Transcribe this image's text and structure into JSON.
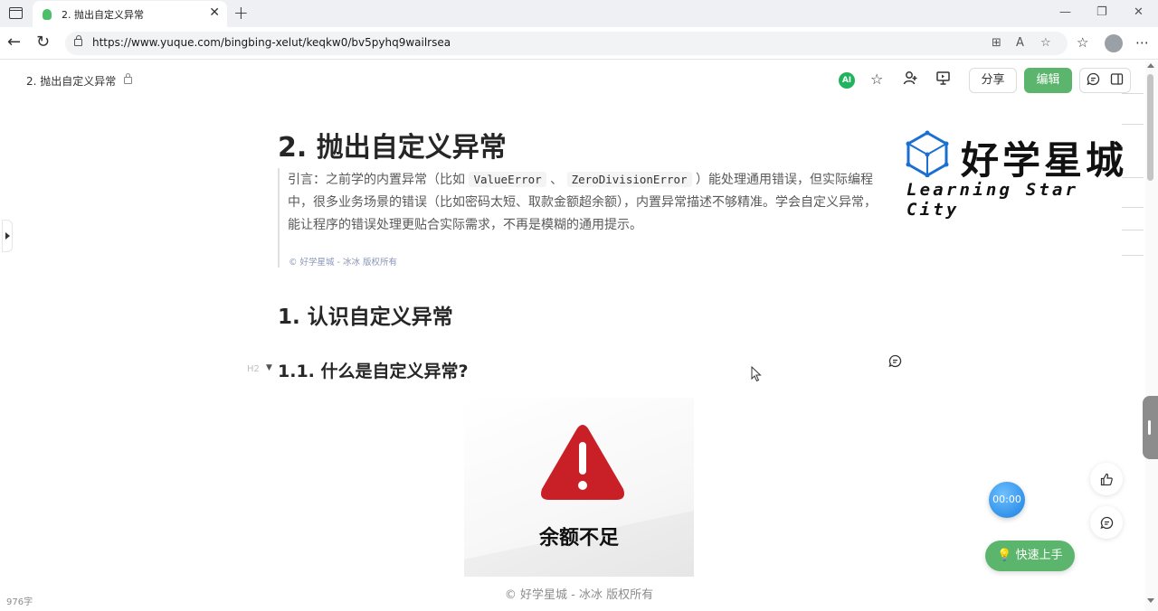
{
  "browser": {
    "tab_title": "2. 抛出自定义异常",
    "tab_close": "✕",
    "new_tab": "+",
    "url": "https://www.yuque.com/bingbing-xelut/keqkw0/bv5pyhq9wailrsea",
    "window_min": "—",
    "window_restore": "❐",
    "window_close": "✕",
    "back": "←",
    "reload": "↻",
    "more": "⋯"
  },
  "header": {
    "doc_title": "2. 抛出自定义异常",
    "ai_label": "AI",
    "share_label": "分享",
    "edit_label": "编辑"
  },
  "article": {
    "title": "2. 抛出自定义异常",
    "quote": {
      "part1": "引言：之前学的内置异常（比如 ",
      "code1": "ValueError",
      "sep": " 、 ",
      "code2": "ZeroDivisionError",
      "part2": " ）能处理通用错误，但实际编程中，很多业务场景的错误（比如密码太短、取款金额超余额），内置异常描述不够精准。学会自定义异常，能让程序的错误处理更贴合实际需求，不再是模糊的通用提示。",
      "copyright": "© 好学星城 - 冰冰 版权所有"
    },
    "logo": {
      "cn": "好学星城",
      "en": "Learning Star City"
    },
    "h2": "1. 认识自定义异常",
    "h3_marker": "H2",
    "h3": "1.1. 什么是自定义异常?",
    "image_label": "余额不足",
    "image_caption": "© 好学星城 - 冰冰 版权所有"
  },
  "footer": {
    "word_count": "976字"
  },
  "floating": {
    "timer": "00:00",
    "quickstart": "快速上手"
  },
  "colors": {
    "accent_green": "#5cb56d",
    "ai_green": "#22b35e",
    "warning_red": "#d1242c",
    "timer_blue": "#1a7fe0"
  },
  "icons": [
    "window-menu-icon",
    "favicon-icon",
    "lock-icon",
    "star-icon",
    "add-user-icon",
    "present-icon",
    "comment-icon",
    "sidebar-icon",
    "warning-icon",
    "thumbs-up-icon",
    "bulb-icon"
  ]
}
